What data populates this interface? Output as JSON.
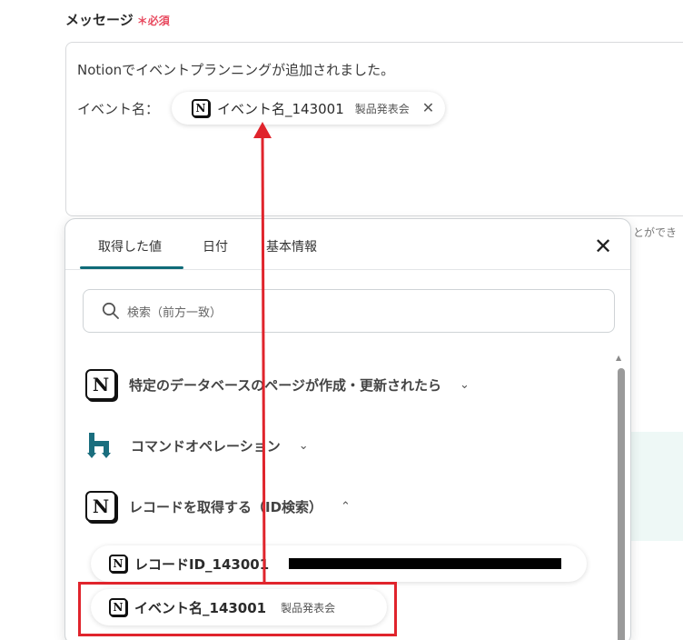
{
  "field": {
    "label": "メッセージ",
    "required_mark": "＊",
    "required_text": "必須"
  },
  "editor": {
    "line1": "Notionでイベントプランニングが追加されました。",
    "line2_label": "イベント名：",
    "chip": {
      "value": "イベント名_143001",
      "sub": "製品発表会",
      "close": "✕"
    }
  },
  "hint_text": "とができ",
  "popup": {
    "tabs": [
      "取得した値",
      "日付",
      "基本情報"
    ],
    "close": "✕",
    "search_placeholder": "検索（前方一致）",
    "sections": [
      {
        "label": "特定のデータベースのページが作成・更新されたら",
        "chevron": "⌄"
      },
      {
        "label": "コマンドオペレーション",
        "chevron": "⌄"
      },
      {
        "label": "レコードを取得する（ID検索）",
        "chevron": "⌃"
      }
    ],
    "items": [
      {
        "label": "レコードID_143001",
        "sub": ""
      },
      {
        "label": "イベント名_143001",
        "sub": "製品発表会"
      }
    ]
  },
  "colors": {
    "accent": "#0f6b78",
    "required": "#e84a5f",
    "annotation": "#e0242c"
  }
}
